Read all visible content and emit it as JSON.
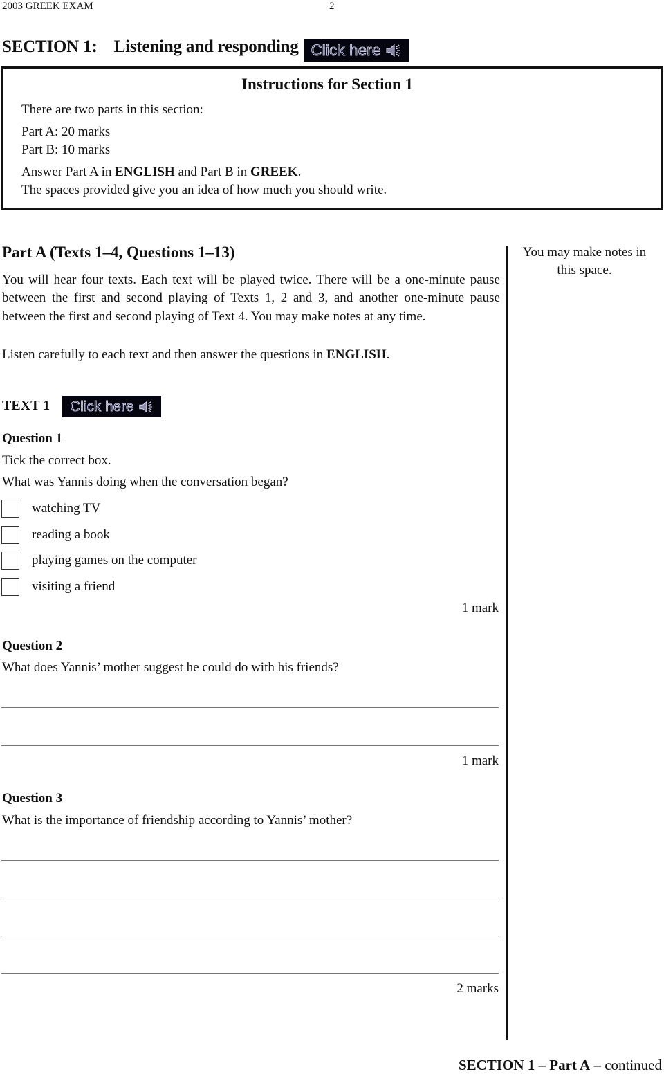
{
  "header": {
    "exam_title": "2003 GREEK EXAM",
    "page_number": "2"
  },
  "section": {
    "label": "SECTION 1:",
    "title": "Listening and responding",
    "audio_button": {
      "label": "Click here",
      "icon": "speaker-icon"
    }
  },
  "instructions": {
    "title": "Instructions for Section 1",
    "intro": "There are two parts in this section:",
    "parts": [
      "Part A: 20 marks",
      "Part B: 10 marks"
    ],
    "answer_line": {
      "pre": "Answer Part A in ",
      "lang_a": "ENGLISH",
      "mid": " and Part B in ",
      "lang_b": "GREEK",
      "post": "."
    },
    "space_note": "The spaces provided give you an idea of how much you should write."
  },
  "part_a": {
    "title": "Part A (Texts 1–4, Questions 1–13)",
    "paragraph": "You will hear four texts. Each text will be played twice. There will be a one-minute pause between the first and second playing of Texts 1, 2 and 3, and another one-minute pause between the first and second playing of Text 4. You may make notes at any time.",
    "listen_line": {
      "pre": "Listen carefully to each text and then answer the questions in ",
      "lang": "ENGLISH",
      "post": "."
    },
    "notes_margin": "You may make notes in this space."
  },
  "text1": {
    "label": "TEXT 1",
    "audio_button": {
      "label": "Click here",
      "icon": "speaker-icon"
    }
  },
  "questions": [
    {
      "heading": "Question 1",
      "instruction": "Tick the correct box.",
      "prompt": "What was Yannis doing when the conversation began?",
      "options": [
        {
          "label": "watching TV",
          "checked": false
        },
        {
          "label": "reading a book",
          "checked": false
        },
        {
          "label": "playing games on the computer",
          "checked": false
        },
        {
          "label": "visiting a friend",
          "checked": false
        }
      ],
      "marks": "1 mark"
    },
    {
      "heading": "Question 2",
      "prompt": "What does Yannis’ mother suggest he could do with his friends?",
      "answer_lines": 2,
      "marks": "1 mark"
    },
    {
      "heading": "Question 3",
      "prompt": "What is the importance of friendship according to Yannis’ mother?",
      "answer_lines": 4,
      "marks": "2 marks"
    }
  ],
  "footer": {
    "section": "SECTION 1",
    "sep1": " – ",
    "part": "Part A",
    "sep2": " – ",
    "status": "continued"
  }
}
